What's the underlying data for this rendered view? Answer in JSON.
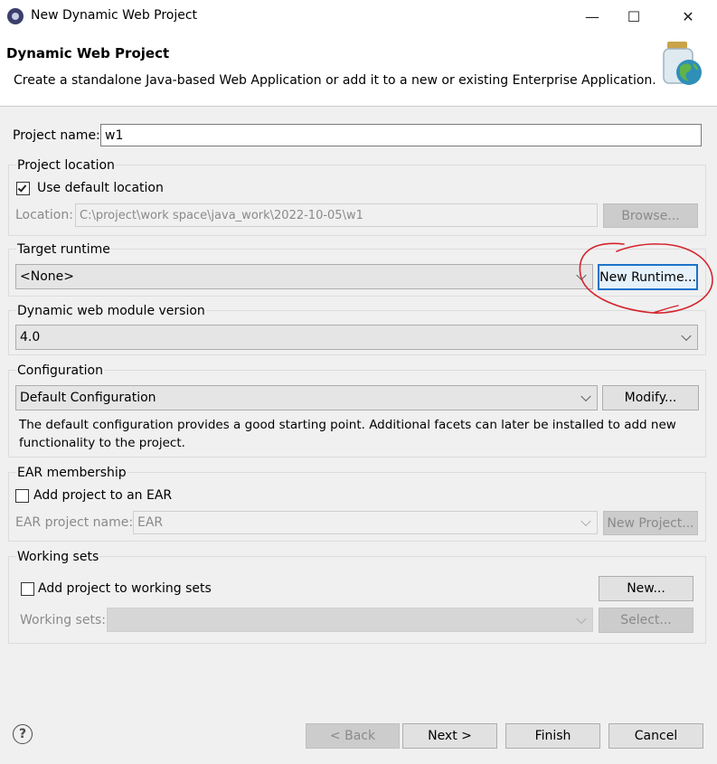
{
  "window": {
    "title": "New Dynamic Web Project",
    "minimize_glyph": "—",
    "maximize_glyph": "☐",
    "close_glyph": "✕"
  },
  "header": {
    "title": "Dynamic Web Project",
    "description": "Create a standalone Java-based Web Application or add it to a new or existing Enterprise Application."
  },
  "project_name": {
    "label": "Project name:",
    "value": "w1"
  },
  "project_location": {
    "title": "Project location",
    "use_default_label": "Use default location",
    "use_default_checked": true,
    "location_label": "Location:",
    "location_value": "C:\\project\\work space\\java_work\\2022-10-05\\w1",
    "browse_label": "Browse..."
  },
  "target_runtime": {
    "title": "Target runtime",
    "selected": "<None>",
    "new_runtime_label": "New Runtime..."
  },
  "web_module": {
    "title": "Dynamic web module version",
    "selected": "4.0"
  },
  "configuration": {
    "title": "Configuration",
    "selected": "Default Configuration",
    "modify_label": "Modify...",
    "desc_line1": "The default configuration provides a good starting point. Additional facets can later be installed to add new",
    "desc_line2": "functionality to the project."
  },
  "ear": {
    "title": "EAR membership",
    "add_label": "Add project to an EAR",
    "project_name_label": "EAR project name:",
    "project_name_value": "EAR",
    "new_project_label": "New Project..."
  },
  "working_sets": {
    "title": "Working sets",
    "add_label": "Add project to working sets",
    "new_label": "New...",
    "sets_label": "Working sets:",
    "select_label": "Select..."
  },
  "footer": {
    "help_glyph": "?",
    "back_label": "< Back",
    "next_label": "Next >",
    "finish_label": "Finish",
    "cancel_label": "Cancel"
  },
  "colors": {
    "annotation_red": "#d4242c",
    "focus_blue": "#1a73c8"
  },
  "icons": [
    "eclipse-app-icon",
    "minimize-icon",
    "maximize-icon",
    "close-icon",
    "wizard-banner-icon",
    "checkmark-icon",
    "chevron-down-icon",
    "help-icon"
  ]
}
